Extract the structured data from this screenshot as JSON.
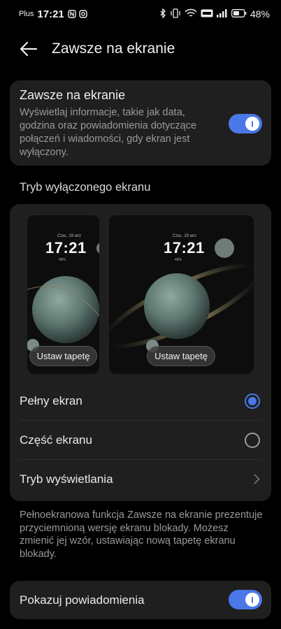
{
  "status_bar": {
    "carrier": "Plus",
    "time": "17:21",
    "battery": "48%"
  },
  "header": {
    "title": "Zawsze na ekranie"
  },
  "aod_card": {
    "title": "Zawsze na ekranie",
    "description": "Wyświetlaj informacje, takie jak data, godzina oraz powiadomienia dotyczące połączeń i wiadomości, gdy ekran jest wyłączony.",
    "enabled": true
  },
  "mode_section": {
    "label": "Tryb wyłączonego ekranu",
    "previews": [
      {
        "date": "Czw., 19 wrz",
        "time": "17:21",
        "battery": "48%",
        "button": "Ustaw tapetę"
      },
      {
        "date": "Czw., 19 wrz",
        "time": "17:21",
        "battery": "48%",
        "button": "Ustaw tapetę"
      }
    ],
    "options": [
      {
        "label": "Pełny ekran",
        "selected": true
      },
      {
        "label": "Część ekranu",
        "selected": false
      }
    ],
    "display_mode_label": "Tryb wyświetlania"
  },
  "footnote": "Pełnoekranowa funkcja Zawsze na ekranie prezentuje przyciemnioną wersję ekranu blokady. Możesz zmienić jej wzór, ustawiając nową tapetę ekranu blokady.",
  "notifications": {
    "label": "Pokazuj powiadomienia",
    "enabled": true
  },
  "colors": {
    "accent": "#4a78e8",
    "background": "#000000",
    "card": "#1f1f1f"
  }
}
